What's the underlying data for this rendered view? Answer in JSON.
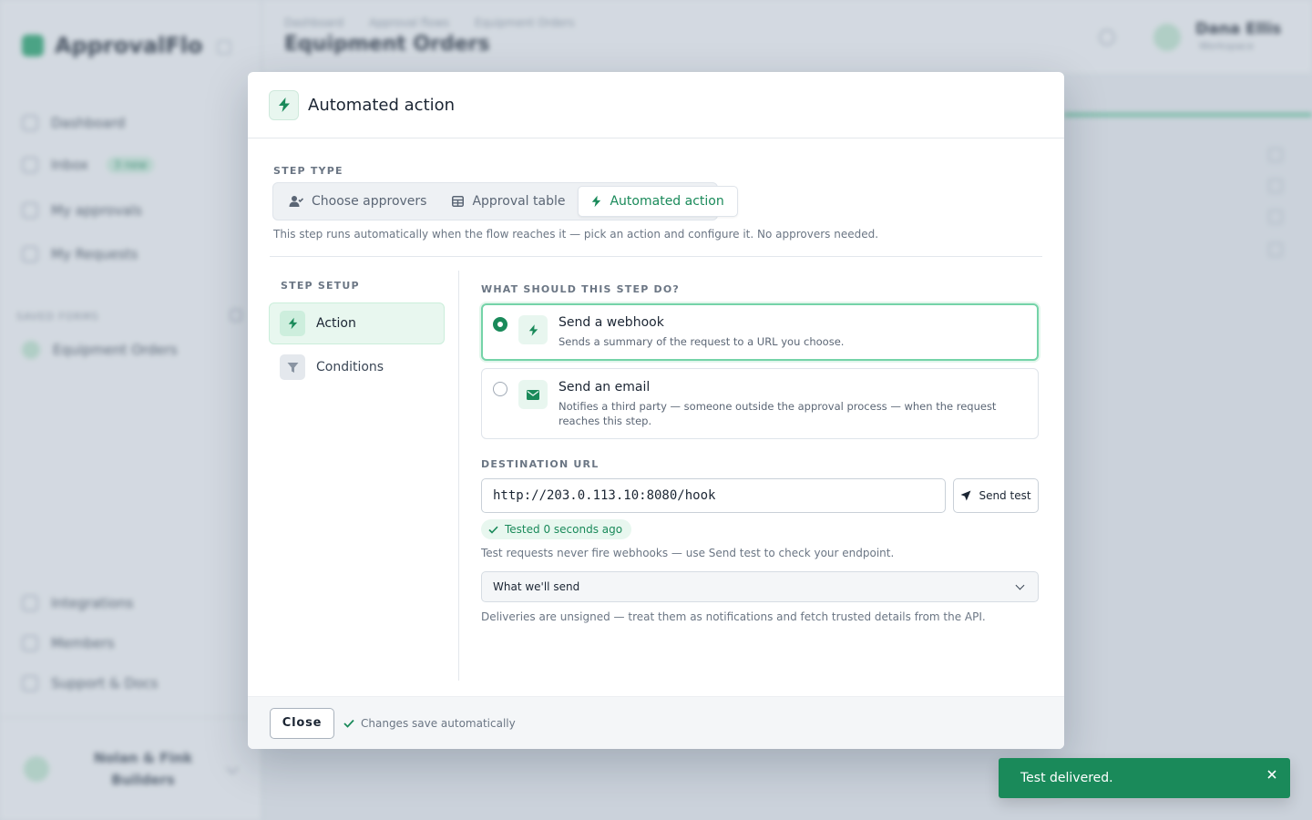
{
  "background": {
    "brand": "ApprovalFlo",
    "nav_items": [
      {
        "label": "Dashboard"
      },
      {
        "label": "Inbox",
        "badge": "3 new"
      },
      {
        "label": "My approvals"
      },
      {
        "label": "My Requests"
      }
    ],
    "section_label": "SAVED FORMS",
    "flows": [
      {
        "label": "Equipment Orders"
      }
    ],
    "footer_items": [
      {
        "label": "Integrations"
      },
      {
        "label": "Members"
      },
      {
        "label": "Support & Docs"
      }
    ],
    "user": {
      "name": "Dana Ellis",
      "sub": "Workspace",
      "workspace": "Nolan & Fink Builders"
    },
    "breadcrumbs": [
      "Dashboard",
      "Approval flows",
      "Equipment Orders"
    ],
    "page_title": "Equipment Orders"
  },
  "modal": {
    "title": "Automated action",
    "step_type_label": "STEP TYPE",
    "segments": [
      {
        "label": "Choose approvers",
        "icon": "user-check-icon",
        "active": false
      },
      {
        "label": "Approval table",
        "icon": "table-icon",
        "active": false
      },
      {
        "label": "Automated action",
        "icon": "bolt-icon",
        "active": true
      }
    ],
    "step_type_help": "This step runs automatically when the flow reaches it — pick an action and configure it. No approvers needed.",
    "setup_label": "STEP SETUP",
    "setup_items": [
      {
        "label": "Action",
        "icon": "bolt-icon",
        "active": true
      },
      {
        "label": "Conditions",
        "icon": "filter-icon",
        "active": false
      }
    ],
    "what_label": "WHAT SHOULD THIS STEP DO?",
    "options": [
      {
        "title": "Send a webhook",
        "desc": "Sends a summary of the request to a URL you choose.",
        "icon": "bolt-icon",
        "selected": true
      },
      {
        "title": "Send an email",
        "desc": "Notifies a third party — someone outside the approval process — when the request reaches this step.",
        "icon": "envelope-icon",
        "selected": false
      }
    ],
    "destination_label": "DESTINATION URL",
    "destination_value": "http://203.0.113.10:8080/hook",
    "send_test_label": "Send test",
    "tested_label": "Tested 0 seconds ago",
    "test_note": "Test requests never fire webhooks — use Send test to check your endpoint.",
    "details_label": "What we'll send",
    "unsigned_note": "Deliveries are unsigned — treat them as notifications and fetch trusted details from the API.",
    "close_label": "Close",
    "autosave_label": "Changes save automatically"
  },
  "toast": {
    "message": "Test delivered."
  },
  "colors": {
    "accent": "#1a8a5a",
    "accent_light": "#e8f7ef",
    "selected_border": "#74d3a8",
    "toast_bg": "#1a8a5a"
  }
}
